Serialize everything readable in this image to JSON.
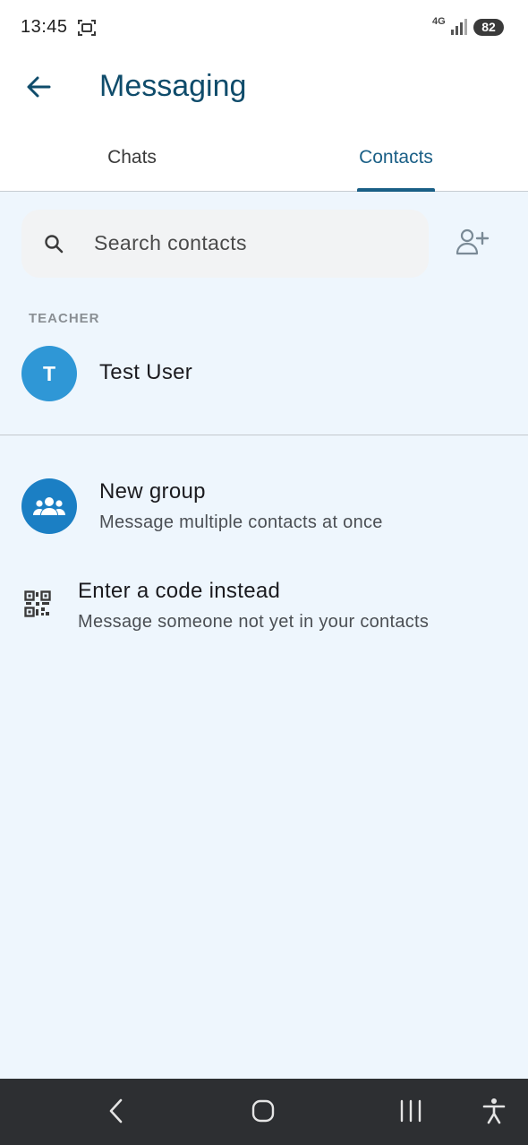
{
  "status_bar": {
    "time": "13:45",
    "network": "4G",
    "battery": "82"
  },
  "app_bar": {
    "title": "Messaging",
    "back_icon": "arrow-left-icon"
  },
  "tabs": [
    {
      "label": "Chats",
      "selected": false
    },
    {
      "label": "Contacts",
      "selected": true
    }
  ],
  "search": {
    "placeholder": "Search contacts",
    "icon": "search-icon",
    "add_contact_icon": "add-person-icon"
  },
  "sections": [
    {
      "label": "TEACHER",
      "contacts": [
        {
          "initial": "T",
          "name": "Test User"
        }
      ]
    }
  ],
  "actions": {
    "new_group": {
      "title": "New group",
      "subtitle": "Message multiple contacts at once",
      "icon": "group-icon"
    },
    "enter_code": {
      "title": "Enter a code instead",
      "subtitle": "Message someone not yet in your contacts",
      "icon": "qr-code-icon"
    }
  },
  "colors": {
    "accent": "#1a5f86",
    "title": "#0f4c6b",
    "background": "#eef6fd",
    "avatar": "#2f97d6",
    "group_avatar": "#1b7fc4",
    "nav_bar": "#2d2f32"
  },
  "nav": {
    "back_icon": "nav-back-icon",
    "home_icon": "nav-home-icon",
    "recents_icon": "nav-recents-icon",
    "accessibility_icon": "accessibility-icon"
  }
}
